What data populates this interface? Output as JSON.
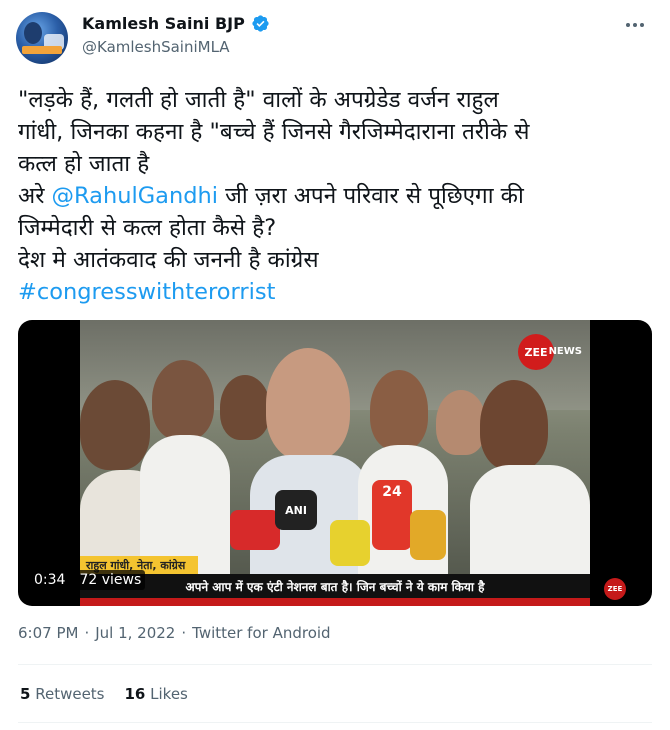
{
  "author": {
    "display_name": "Kamlesh Saini BJP",
    "handle": "@KamleshSainiMLA"
  },
  "tweet": {
    "lines": [
      {
        "text": "\"लड़के हैं, गलती हो जाती है\" वालों के अपग्रेडेड वर्जन राहुल"
      },
      {
        "text": "गांधी, जिनका कहना है \"बच्चे हैं जिनसे गैरजिम्मेदाराना तरीके से"
      },
      {
        "text": "कत्ल हो जाता है"
      },
      {
        "pre": "अरे ",
        "mention": "@RahulGandhi",
        "post": " जी ज़रा अपने परिवार से पूछिएगा की"
      },
      {
        "text": "जिम्मेदारी से कत्ल होता कैसे है?"
      },
      {
        "text": "देश मे आतंकवाद की जननी है कांग्रेस"
      }
    ],
    "hashtag": "#congresswithterorrist"
  },
  "video": {
    "duration": "0:34",
    "views": "72 views",
    "lower_third_name": "राहुल गांधी, नेता, कांग्रेस",
    "ticker_text": "अपने आप में एक एंटी नेशनल बात है। जिन बच्चों ने ये काम किया है",
    "channel_logo": "ZEE",
    "channel_name": "NEWS",
    "mic_label": "ANI",
    "mic_label_2": "24"
  },
  "meta": {
    "time": "6:07 PM",
    "separator": "·",
    "date": "Jul 1, 2022",
    "source": "Twitter for Android"
  },
  "stats": {
    "retweets_count": "5",
    "retweets_label": "Retweets",
    "likes_count": "16",
    "likes_label": "Likes"
  },
  "colors": {
    "link": "#1d9bf0",
    "secondary_text": "#536471",
    "verified_badge": "#1d9bf0"
  }
}
